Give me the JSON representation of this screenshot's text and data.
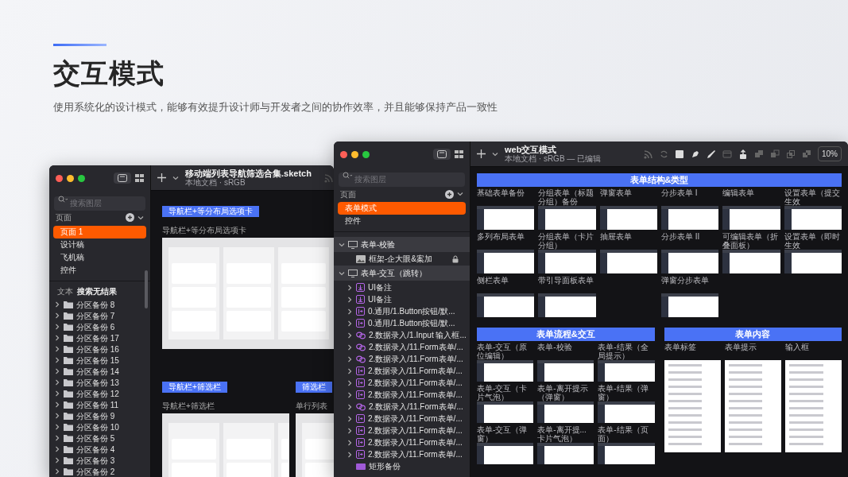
{
  "header": {
    "title": "交互模式",
    "subtitle": "使用系统化的设计模式，能够有效提升设计师与开发者之间的协作效率，并且能够保持产品一致性"
  },
  "left_window": {
    "title": "移动端列表导航筛选合集.sketch",
    "subtitle": "本地文档 · sRGB",
    "search": {
      "placeholder": "搜索图层"
    },
    "pages_label": "页面",
    "pages": [
      {
        "label": "页面 1",
        "selected": true
      },
      {
        "label": "设计稿",
        "selected": false
      },
      {
        "label": "飞机稿",
        "selected": false
      },
      {
        "label": "控件",
        "selected": false
      }
    ],
    "filter": {
      "tag": "文本",
      "text": "搜索无结果"
    },
    "layers": [
      {
        "kind": "folder",
        "label": "分区备份 8",
        "expanded": false
      },
      {
        "kind": "folder",
        "label": "分区备份 7",
        "expanded": false
      },
      {
        "kind": "folder",
        "label": "分区备份 6",
        "expanded": false
      },
      {
        "kind": "folder",
        "label": "分区备份 17",
        "expanded": false
      },
      {
        "kind": "folder",
        "label": "分区备份 16",
        "expanded": false
      },
      {
        "kind": "folder",
        "label": "分区备份 15",
        "expanded": false
      },
      {
        "kind": "folder",
        "label": "分区备份 14",
        "expanded": false
      },
      {
        "kind": "folder",
        "label": "分区备份 13",
        "expanded": false
      },
      {
        "kind": "folder",
        "label": "分区备份 12",
        "expanded": false
      },
      {
        "kind": "folder",
        "label": "分区备份 11",
        "expanded": false
      },
      {
        "kind": "folder",
        "label": "分区备份 9",
        "expanded": false
      },
      {
        "kind": "folder",
        "label": "分区备份 10",
        "expanded": false
      },
      {
        "kind": "folder",
        "label": "分区备份 5",
        "expanded": false
      },
      {
        "kind": "folder",
        "label": "分区备份 4",
        "expanded": false
      },
      {
        "kind": "folder",
        "label": "分区备份 3",
        "expanded": false
      },
      {
        "kind": "folder",
        "label": "分区备份 2",
        "expanded": false
      }
    ],
    "board_rows": [
      [
        {
          "banner": "导航栏+等分布局选项卡",
          "label": "导航栏+等分布局选项卡"
        }
      ],
      [
        {
          "banner": "导航栏+筛选栏",
          "label": "导航栏+筛选栏"
        },
        {
          "banner": "筛选栏",
          "label": "单行列表"
        }
      ]
    ]
  },
  "right_window": {
    "title": "web交互模式",
    "subtitle": "本地文档 · sRGB — 已编辑",
    "zoom": "10%",
    "search": {
      "placeholder": "搜索图层"
    },
    "pages_label": "页面",
    "pages": [
      {
        "label": "表单模式",
        "selected": true
      },
      {
        "label": "控件",
        "selected": false
      }
    ],
    "layers": [
      {
        "kind": "screen",
        "label": "表单-校验",
        "expanded": true,
        "children": [
          {
            "kind": "image",
            "label": "框架-企大眼&案加",
            "locked": true
          }
        ]
      },
      {
        "kind": "screen",
        "label": "表单-交互（跳转）",
        "expanded": true,
        "children": [
          {
            "kind": "note",
            "label": "UI备注",
            "expanded": false
          },
          {
            "kind": "note",
            "label": "UI备注",
            "expanded": false
          },
          {
            "kind": "symbol",
            "label": "0.通用/1.Button按钮/默...",
            "expanded": false
          },
          {
            "kind": "symbol",
            "label": "0.通用/1.Button按钮/默...",
            "expanded": false
          },
          {
            "kind": "linked",
            "label": "2.数据录入/1.Input 输入框...",
            "expanded": false
          },
          {
            "kind": "linked",
            "label": "2.数据录入/11.Form表单/...",
            "expanded": false
          },
          {
            "kind": "linked",
            "label": "2.数据录入/11.Form表单/...",
            "expanded": false
          },
          {
            "kind": "symbol",
            "label": "2.数据录入/11.Form表单/...",
            "expanded": false
          },
          {
            "kind": "symbol",
            "label": "2.数据录入/11.Form表单/...",
            "expanded": false
          },
          {
            "kind": "symbol",
            "label": "2.数据录入/11.Form表单/...",
            "expanded": false
          },
          {
            "kind": "linked",
            "label": "2.数据录入/11.Form表单/...",
            "expanded": false
          },
          {
            "kind": "symbol",
            "label": "2.数据录入/11.Form表单/...",
            "expanded": false
          },
          {
            "kind": "symbol",
            "label": "2.数据录入/11.Form表单/...",
            "expanded": false
          },
          {
            "kind": "symbol",
            "label": "2.数据录入/11.Form表单/...",
            "expanded": false
          },
          {
            "kind": "symbol",
            "label": "2.数据录入/11.Form表单/...",
            "expanded": false
          },
          {
            "kind": "rect",
            "label": "矩形备份"
          }
        ]
      }
    ],
    "sections": [
      {
        "kind": "screens",
        "banner": "表单结构&类型",
        "columns": [
          [
            "基础表单备份",
            "多列布局表单",
            "侧栏表单"
          ],
          [
            "分组表单（标题分组）备份",
            "分组表单（卡片分组）",
            "带引导面板表单"
          ],
          [
            "弹窗表单",
            "抽屉表单"
          ],
          [
            "分步表单 I",
            "分步表单 II",
            "弹窗分步表单"
          ],
          [
            "编辑表单",
            "可编辑表单（折叠面板）"
          ],
          [
            "设置表单（提交生效",
            "设置表单（即时生效"
          ]
        ]
      },
      {
        "kind": "screens",
        "banner": "表单流程&交互",
        "columns": [
          [
            "表单-交互（原位编辑）",
            "表单-交互（卡片气泡）",
            "表单-交互（弹窗）"
          ],
          [
            "表单-校验",
            "表单-离开提示（弹窗）",
            "表单-离开提...卡片气泡）"
          ],
          [
            "表单-结果（全局提示）",
            "表单-结果（弹窗）",
            "表单-结果（页面）"
          ]
        ]
      },
      {
        "kind": "documents",
        "banner": "表单内容",
        "columns": [
          [
            "表单标签"
          ],
          [
            "表单提示"
          ],
          [
            "输入框"
          ]
        ]
      }
    ]
  }
}
